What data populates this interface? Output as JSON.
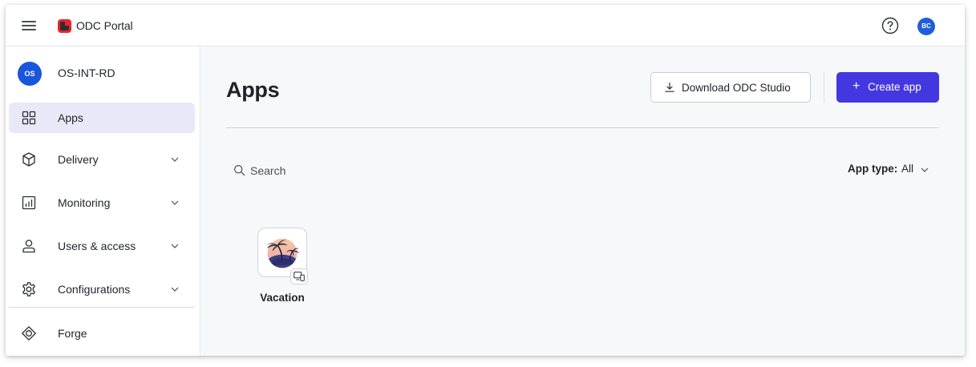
{
  "topbar": {
    "brand": "ODC Portal",
    "avatar_initials": "BC",
    "icons": {
      "menu": "hamburger-icon",
      "help": "question-circle-icon"
    }
  },
  "sidebar": {
    "org_initials": "OS",
    "org_name": "OS-INT-RD",
    "items": [
      {
        "label": "Apps",
        "icon": "grid-icon",
        "active": true,
        "expandable": false
      },
      {
        "label": "Delivery",
        "icon": "cube-icon",
        "active": false,
        "expandable": true
      },
      {
        "label": "Monitoring",
        "icon": "chart-icon",
        "active": false,
        "expandable": true
      },
      {
        "label": "Users & access",
        "icon": "user-icon",
        "active": false,
        "expandable": true
      },
      {
        "label": "Configurations",
        "icon": "gear-icon",
        "active": false,
        "expandable": true
      },
      {
        "label": "Forge",
        "icon": "forge-icon",
        "active": false,
        "expandable": false
      }
    ]
  },
  "main": {
    "title": "Apps",
    "download_label": "Download ODC Studio",
    "create_label": "Create app",
    "search_placeholder": "Search",
    "app_type_label": "App type:",
    "app_type_value": "All",
    "apps": [
      {
        "name": "Vacation",
        "icon": "palm-island-icon",
        "badge": "multi-device-icon"
      }
    ]
  },
  "colors": {
    "accent": "#4338e0",
    "active_nav_bg": "#e7e8f8",
    "avatar_blue": "#1f5fd6"
  }
}
